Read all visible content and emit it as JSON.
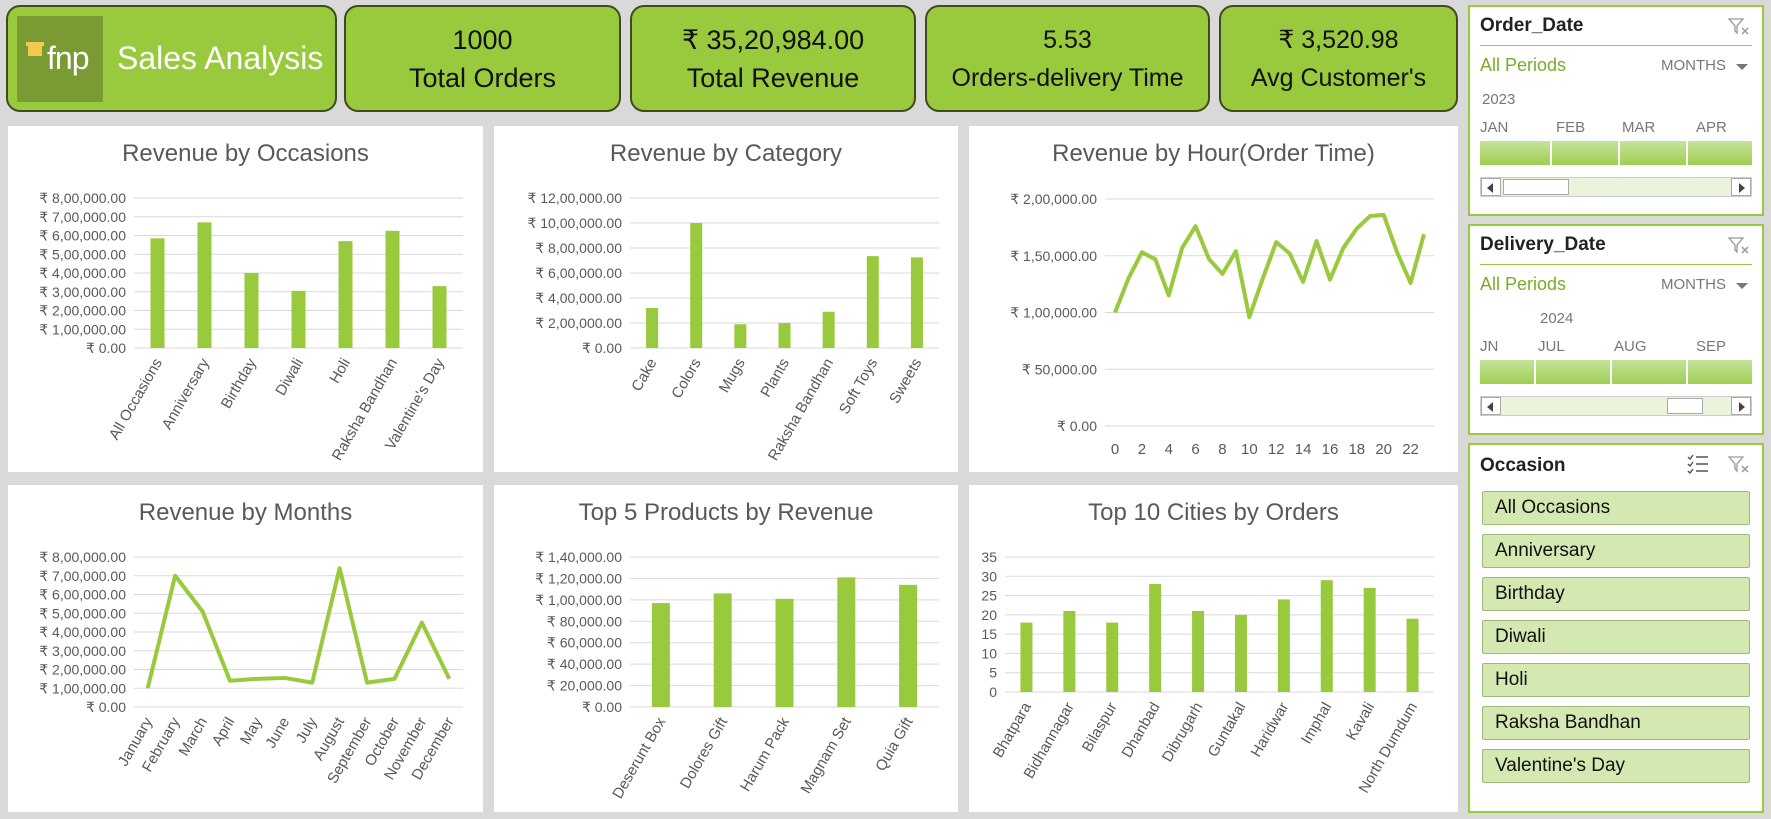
{
  "header": {
    "logo_text": "fnp",
    "title": "Sales Analysis",
    "kpis": [
      {
        "value": "1000",
        "label": "Total Orders"
      },
      {
        "value": "₹ 35,20,984.00",
        "label": "Total Revenue"
      },
      {
        "value": "5.53",
        "label": "Orders-delivery Time"
      },
      {
        "value": "₹ 3,520.98",
        "label": "Avg Customer's"
      }
    ]
  },
  "colors": {
    "accent": "#99c93c",
    "line": "#99c93c",
    "grid": "#d9d9d9",
    "tick": "#595959"
  },
  "chart_data": [
    {
      "id": "occasions",
      "type": "bar",
      "title": "Revenue by Occasions",
      "categories": [
        "All Occasions",
        "Anniversary",
        "Birthday",
        "Diwali",
        "Holi",
        "Raksha Bandhan",
        "Valentine's Day"
      ],
      "values": [
        585000,
        670000,
        400000,
        305000,
        570000,
        625000,
        330000
      ],
      "ylim": [
        0,
        800000
      ],
      "yticks": [
        "₹ 0.00",
        "₹ 1,00,000.00",
        "₹ 2,00,000.00",
        "₹ 3,00,000.00",
        "₹ 4,00,000.00",
        "₹ 5,00,000.00",
        "₹ 6,00,000.00",
        "₹ 7,00,000.00",
        "₹ 8,00,000.00"
      ]
    },
    {
      "id": "category",
      "type": "bar",
      "title": "Revenue by Category",
      "categories": [
        "Cake",
        "Colors",
        "Mugs",
        "Plants",
        "Raksha Bandhan",
        "Soft Toys",
        "Sweets"
      ],
      "values": [
        320000,
        1000000,
        190000,
        200000,
        290000,
        735000,
        725000
      ],
      "ylim": [
        0,
        1200000
      ],
      "yticks": [
        "₹ 0.00",
        "₹ 2,00,000.00",
        "₹ 4,00,000.00",
        "₹ 6,00,000.00",
        "₹ 8,00,000.00",
        "₹ 10,00,000.00",
        "₹ 12,00,000.00"
      ]
    },
    {
      "id": "hour",
      "type": "line",
      "title": "Revenue by Hour(Order Time)",
      "x": [
        0,
        1,
        2,
        3,
        4,
        5,
        6,
        7,
        8,
        9,
        10,
        11,
        12,
        13,
        14,
        15,
        16,
        17,
        18,
        19,
        20,
        21,
        22,
        23
      ],
      "values": [
        100000,
        130000,
        153000,
        147000,
        115000,
        157000,
        176000,
        147000,
        134000,
        154000,
        96000,
        130000,
        162000,
        152000,
        127000,
        163000,
        129000,
        157000,
        174000,
        185000,
        186000,
        153000,
        126000,
        169000
      ],
      "xticks": [
        "0",
        "2",
        "4",
        "6",
        "8",
        "10",
        "12",
        "14",
        "16",
        "18",
        "20",
        "22"
      ],
      "ylim": [
        0,
        200000
      ],
      "yticks": [
        "₹ 0.00",
        "₹ 50,000.00",
        "₹ 1,00,000.00",
        "₹ 1,50,000.00",
        "₹ 2,00,000.00"
      ]
    },
    {
      "id": "months",
      "type": "line",
      "title": "Revenue by Months",
      "categories": [
        "January",
        "February",
        "March",
        "April",
        "May",
        "June",
        "July",
        "August",
        "September",
        "October",
        "November",
        "December"
      ],
      "values": [
        100000,
        700000,
        510000,
        140000,
        150000,
        155000,
        130000,
        740000,
        130000,
        150000,
        450000,
        150000
      ],
      "ylim": [
        0,
        800000
      ],
      "yticks": [
        "₹ 0.00",
        "₹ 1,00,000.00",
        "₹ 2,00,000.00",
        "₹ 3,00,000.00",
        "₹ 4,00,000.00",
        "₹ 5,00,000.00",
        "₹ 6,00,000.00",
        "₹ 7,00,000.00",
        "₹ 8,00,000.00"
      ]
    },
    {
      "id": "products",
      "type": "bar",
      "title": "Top 5 Products by Revenue",
      "categories": [
        "Deserunt Box",
        "Dolores Gift",
        "Harum Pack",
        "Magnam Set",
        "Quia Gift"
      ],
      "values": [
        97000,
        106000,
        101000,
        121000,
        114000
      ],
      "ylim": [
        0,
        140000
      ],
      "yticks": [
        "₹ 0.00",
        "₹ 20,000.00",
        "₹ 40,000.00",
        "₹ 60,000.00",
        "₹ 80,000.00",
        "₹ 1,00,000.00",
        "₹ 1,20,000.00",
        "₹ 1,40,000.00"
      ]
    },
    {
      "id": "cities",
      "type": "bar",
      "title": "Top 10 Cities by Orders",
      "categories": [
        "Bhatpara",
        "Bidhannagar",
        "Bilaspur",
        "Dhanbad",
        "Dibrugarh",
        "Guntakal",
        "Haridwar",
        "Imphal",
        "Kavali",
        "North Dumdum"
      ],
      "values": [
        18,
        21,
        18,
        28,
        21,
        20,
        24,
        29,
        27,
        19
      ],
      "ylim": [
        0,
        35
      ],
      "yticks": [
        "0",
        "5",
        "10",
        "15",
        "20",
        "25",
        "30",
        "35"
      ]
    }
  ],
  "slicers": {
    "order_date": {
      "title": "Order_Date",
      "all_label": "All Periods",
      "level": "MONTHS",
      "year": "2023",
      "months": [
        "JAN",
        "FEB",
        "MAR",
        "APR"
      ]
    },
    "delivery_date": {
      "title": "Delivery_Date",
      "all_label": "All Periods",
      "level": "MONTHS",
      "year": "2024",
      "months": [
        "JN",
        "JUL",
        "AUG",
        "SEP"
      ]
    },
    "occasion": {
      "title": "Occasion",
      "items": [
        "All Occasions",
        "Anniversary",
        "Birthday",
        "Diwali",
        "Holi",
        "Raksha Bandhan",
        "Valentine's Day"
      ]
    }
  }
}
